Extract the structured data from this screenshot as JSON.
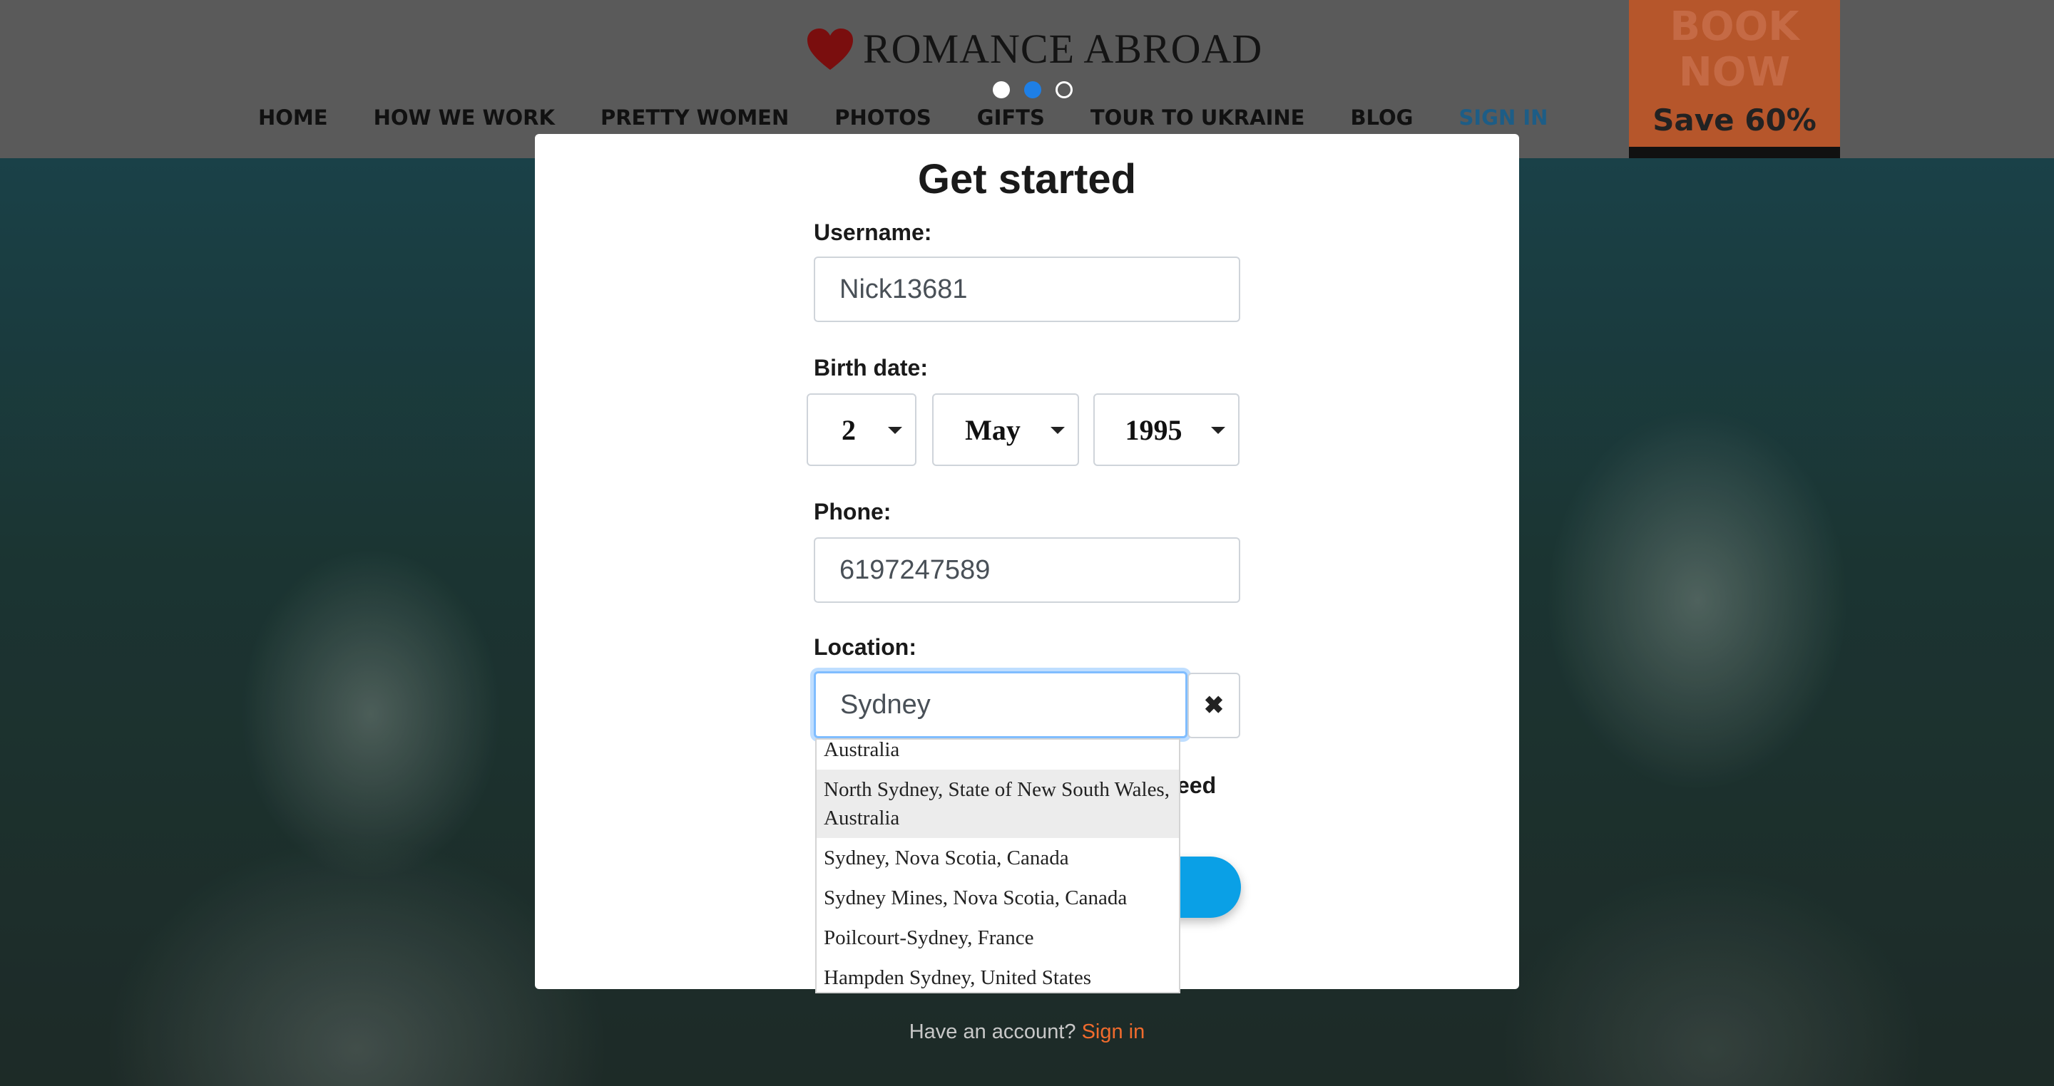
{
  "header": {
    "logo_text": "ROMANCE ABROAD",
    "nav": [
      "HOME",
      "HOW WE WORK",
      "PRETTY WOMEN",
      "PHOTOS",
      "GIFTS",
      "TOUR TO UKRAINE",
      "BLOG",
      "SIGN IN"
    ],
    "book_line1": "BOOK",
    "book_line2": "NOW",
    "book_line3": "Save 60%"
  },
  "modal": {
    "title": "Get started",
    "username_label": "Username:",
    "username_value": "Nick13681",
    "birth_label": "Birth date:",
    "birth_day": "2",
    "birth_month": "May",
    "birth_year": "1995",
    "phone_label": "Phone:",
    "phone_value": "6197247589",
    "location_label": "Location:",
    "location_value": "Sydney",
    "clear_icon": "✖",
    "partial_text": "eed"
  },
  "dropdown": {
    "items": [
      "Australia",
      "North Sydney, State of New South Wales, Australia",
      "Sydney, Nova Scotia, Canada",
      "Sydney Mines, Nova Scotia, Canada",
      "Poilcourt-Sydney, France",
      "Hampden Sydney, United States"
    ]
  },
  "footer": {
    "account_text": "Have an account?",
    "signin_link": "Sign in"
  },
  "colors": {
    "header_bg": "#5a5a5a",
    "accent_blue": "#0aa0e6",
    "link_orange": "#f06b2d",
    "book_orange": "#b6562b"
  }
}
